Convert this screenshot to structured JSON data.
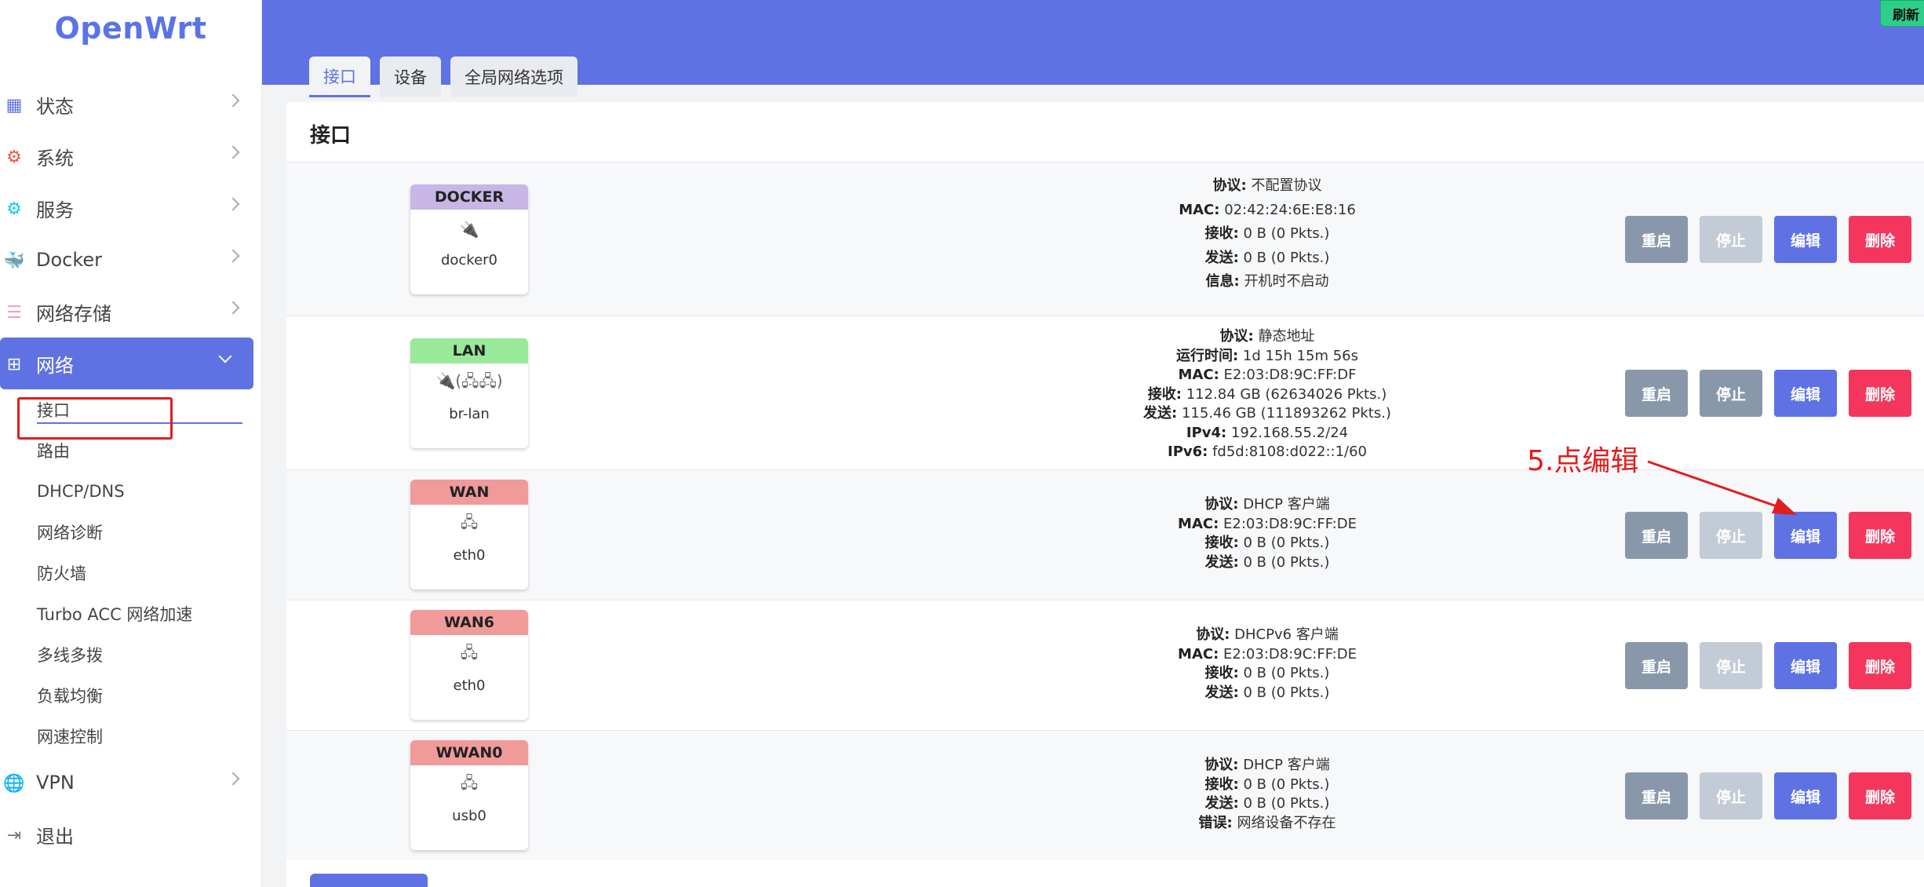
{
  "brand": "OpenWrt",
  "sidebar": {
    "items": [
      {
        "label": "状态"
      },
      {
        "label": "系统"
      },
      {
        "label": "服务"
      },
      {
        "label": "Docker"
      },
      {
        "label": "网络存储"
      },
      {
        "label": "网络"
      }
    ],
    "network_sub": [
      {
        "label": "接口"
      },
      {
        "label": "路由"
      },
      {
        "label": "DHCP/DNS"
      },
      {
        "label": "网络诊断"
      },
      {
        "label": "防火墙"
      },
      {
        "label": "Turbo ACC 网络加速"
      },
      {
        "label": "多线多拨"
      },
      {
        "label": "负载均衡"
      },
      {
        "label": "网速控制"
      }
    ],
    "after": [
      {
        "label": "VPN"
      },
      {
        "label": "退出"
      }
    ]
  },
  "header": {
    "refresh_label": "刷新",
    "tabs": [
      {
        "label": "接口"
      },
      {
        "label": "设备"
      },
      {
        "label": "全局网络选项"
      }
    ]
  },
  "panel": {
    "title": "接口"
  },
  "buttons": {
    "restart": "重启",
    "stop": "停止",
    "edit": "编辑",
    "delete": "删除"
  },
  "interfaces": [
    {
      "name": "DOCKER",
      "color": "#c7b6e6",
      "icon": "🔌",
      "device": "docker0",
      "lines": [
        {
          "k": "协议:",
          "v": " 不配置协议"
        },
        {
          "k": "MAC:",
          "v": " 02:42:24:6E:E8:16"
        },
        {
          "k": "接收:",
          "v": " 0 B (0 Pkts.)"
        },
        {
          "k": "发送:",
          "v": " 0 B (0 Pkts.)"
        },
        {
          "k": "信息:",
          "v": " 开机时不启动"
        }
      ]
    },
    {
      "name": "LAN",
      "color": "#9ae89a",
      "icon": "🔌(🖧🖧)",
      "device": "br-lan",
      "lines": [
        {
          "k": "协议:",
          "v": " 静态地址"
        },
        {
          "k": "运行时间:",
          "v": " 1d 15h 15m 56s"
        },
        {
          "k": "MAC:",
          "v": " E2:03:D8:9C:FF:DF"
        },
        {
          "k": "接收:",
          "v": " 112.84 GB (62634026 Pkts.)"
        },
        {
          "k": "发送:",
          "v": " 115.46 GB (111893262 Pkts.)"
        },
        {
          "k": "IPv4:",
          "v": " 192.168.55.2/24"
        },
        {
          "k": "IPv6:",
          "v": " fd5d:8108:d022::1/60"
        }
      ]
    },
    {
      "name": "WAN",
      "color": "#f09a9a",
      "icon": "🖧",
      "device": "eth0",
      "lines": [
        {
          "k": "协议:",
          "v": " DHCP 客户端"
        },
        {
          "k": "MAC:",
          "v": " E2:03:D8:9C:FF:DE"
        },
        {
          "k": "接收:",
          "v": " 0 B (0 Pkts.)"
        },
        {
          "k": "发送:",
          "v": " 0 B (0 Pkts.)"
        }
      ]
    },
    {
      "name": "WAN6",
      "color": "#f09a9a",
      "icon": "🖧",
      "device": "eth0",
      "lines": [
        {
          "k": "协议:",
          "v": " DHCPv6 客户端"
        },
        {
          "k": "MAC:",
          "v": " E2:03:D8:9C:FF:DE"
        },
        {
          "k": "接收:",
          "v": " 0 B (0 Pkts.)"
        },
        {
          "k": "发送:",
          "v": " 0 B (0 Pkts.)"
        }
      ]
    },
    {
      "name": "WWAN0",
      "color": "#f09a9a",
      "icon": "🖧",
      "device": "usb0",
      "lines": [
        {
          "k": "协议:",
          "v": " DHCP 客户端"
        },
        {
          "k": "接收:",
          "v": " 0 B (0 Pkts.)"
        },
        {
          "k": "发送:",
          "v": " 0 B (0 Pkts.)"
        },
        {
          "k": "错误:",
          "v": " 网络设备不存在"
        }
      ]
    }
  ],
  "annotation": "5.点编辑"
}
